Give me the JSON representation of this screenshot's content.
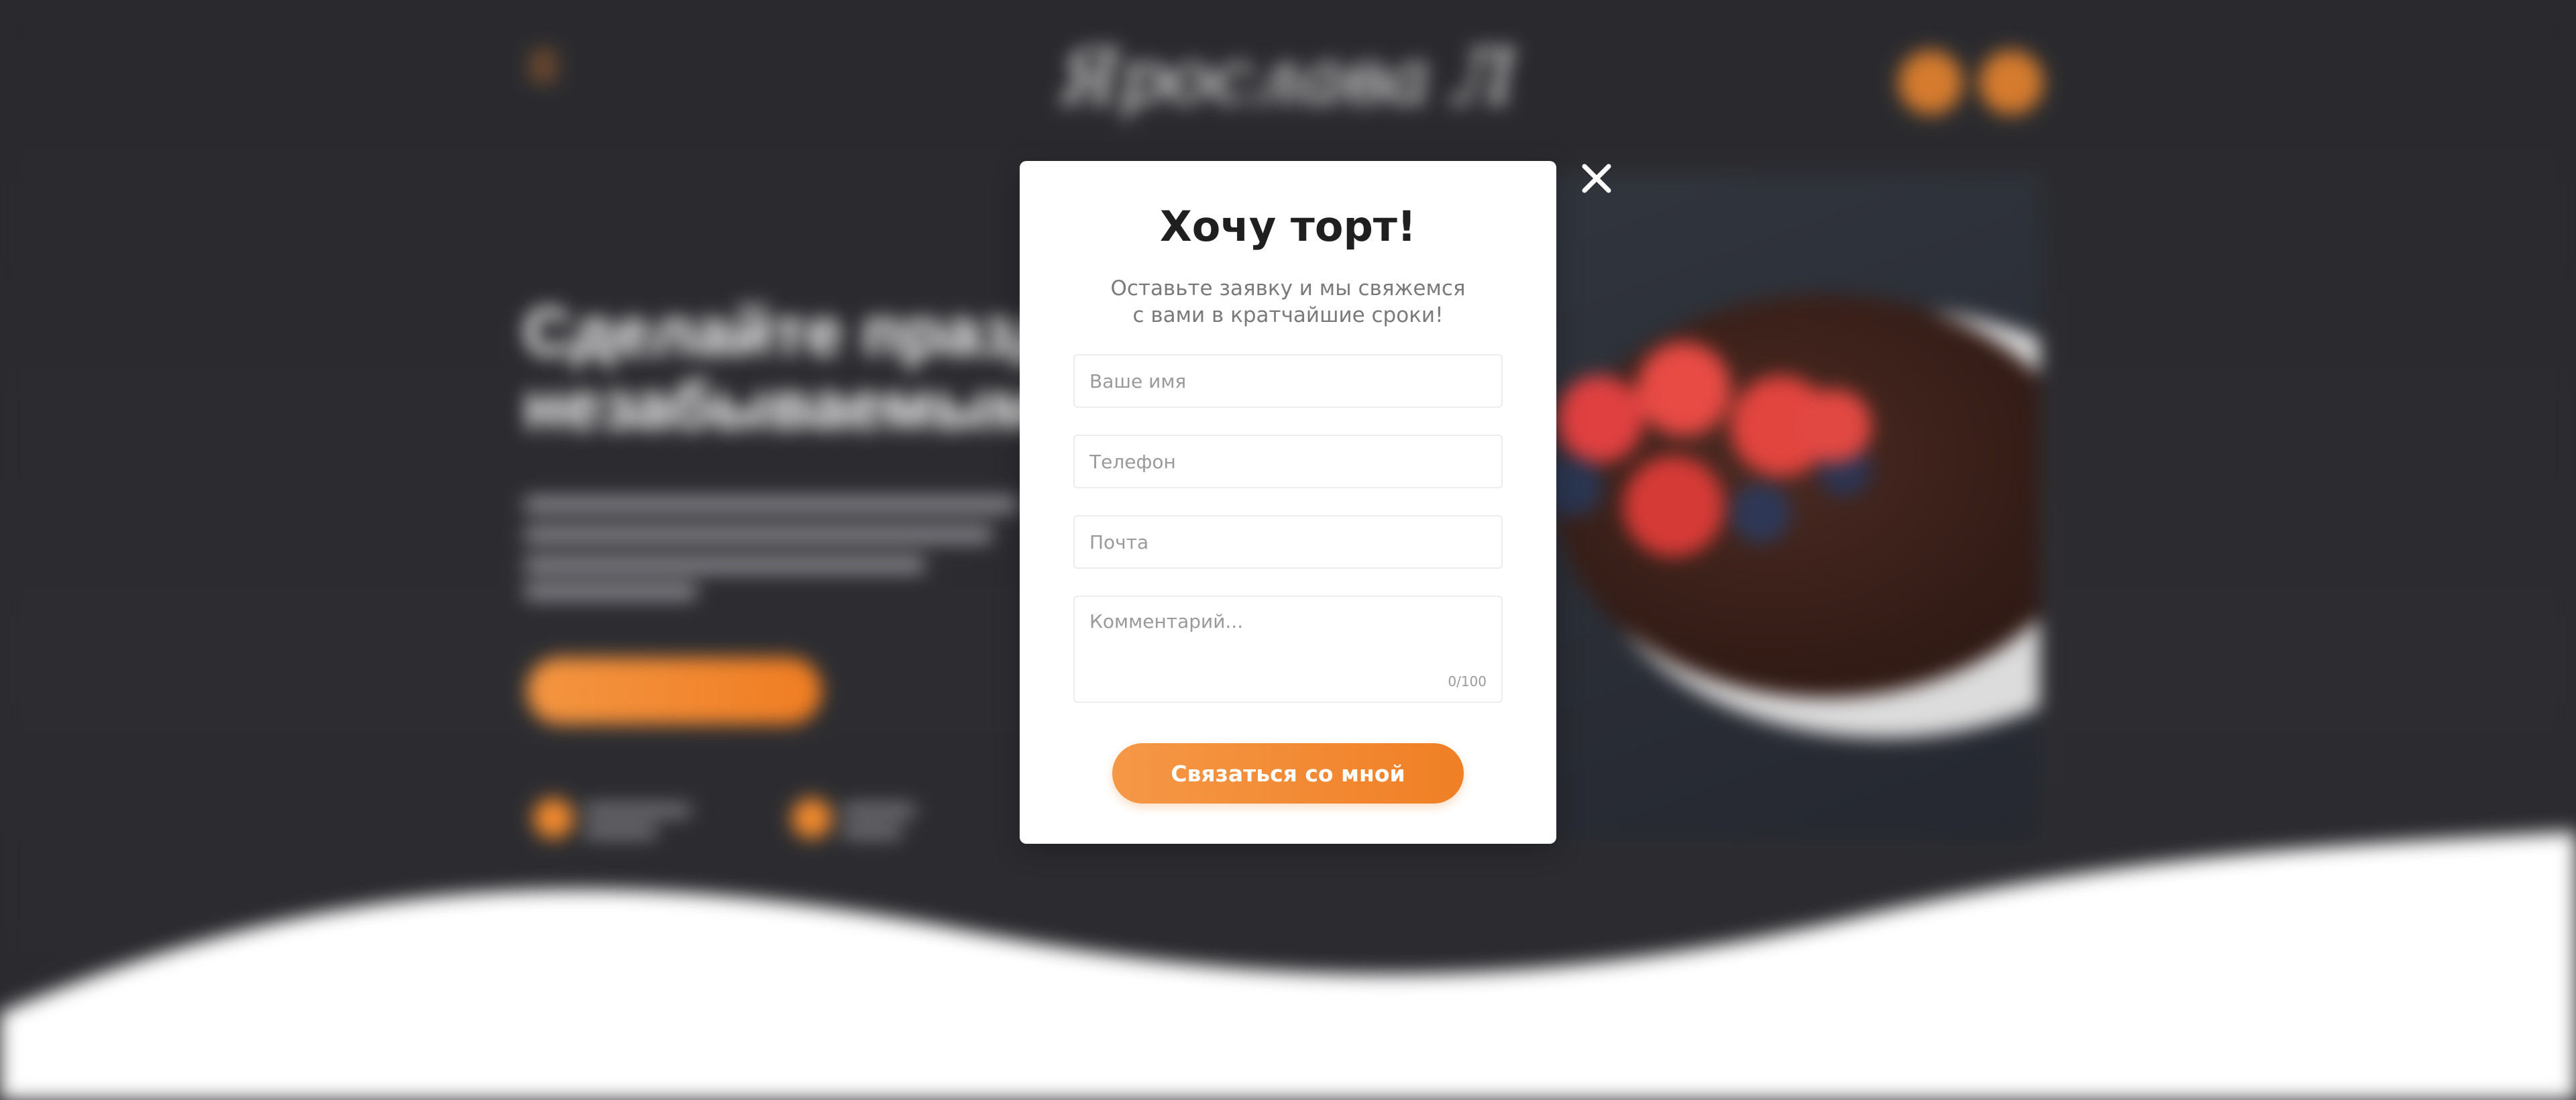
{
  "background": {
    "logo_text": "Ярослава Лисина",
    "heading_line1": "Сделайте праздник",
    "heading_line2": "незабываемым"
  },
  "modal": {
    "title": "Хочу торт!",
    "subtitle_line1": "Оставьте заявку и мы свяжемся",
    "subtitle_line2": "с вами в кратчайшие сроки!",
    "fields": {
      "name_placeholder": "Ваше имя",
      "phone_placeholder": "Телефон",
      "email_placeholder": "Почта",
      "comment_placeholder": "Комментарий...",
      "comment_counter": "0/100"
    },
    "submit_label": "Связаться со мной"
  },
  "colors": {
    "accent": "#f28a2e",
    "background_dark": "#2b2b2f",
    "modal_bg": "#ffffff",
    "title": "#1f1f1f",
    "subtitle": "#7a7a7a"
  },
  "icons": {
    "close": "close-icon",
    "menu": "menu-icon"
  }
}
